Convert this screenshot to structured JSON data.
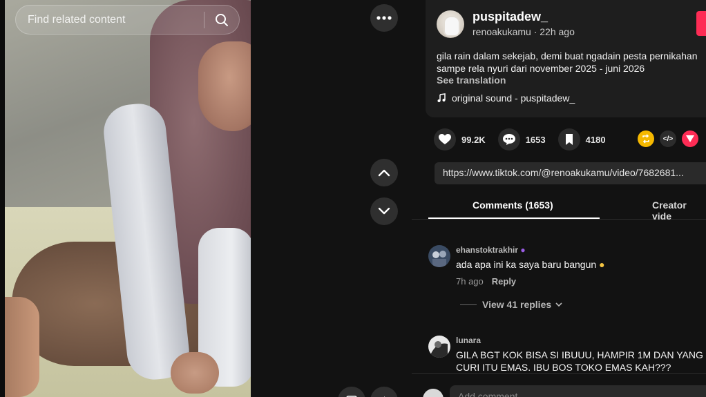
{
  "search": {
    "placeholder": "Find related content"
  },
  "post": {
    "username": "puspitadew_",
    "handle_time": "renoakukamu · 22h ago",
    "description_line1": "gila rain dalam sekejab, demi buat ngadain pesta pernikahan",
    "description_line2": "sampe rela nyuri dari november 2025 - juni 2026",
    "see_translation": "See translation",
    "sound": "original sound - puspitadew_"
  },
  "actions": {
    "likes": "99.2K",
    "comments": "1653",
    "saves": "4180"
  },
  "link": "https://www.tiktok.com/@renoakukamu/video/7682681...",
  "tabs": [
    {
      "label": "Comments (1653)"
    },
    {
      "label": "Creator vide"
    }
  ],
  "comments": [
    {
      "username": "ehanstoktrakhir",
      "text": "ada apa ini ka saya baru bangun",
      "time": "7h ago",
      "reply": "Reply",
      "view_replies": "View 41 replies"
    },
    {
      "username": "lunara",
      "text_line1": "GILA BGT KOK BISA SI IBUUU, HAMPIR 1M DAN YANG",
      "text_line2": "CURI ITU EMAS. IBU BOS TOKO EMAS KAH???"
    }
  ],
  "add_comment": {
    "placeholder": "Add comment..."
  },
  "icons": {
    "search": "search-icon",
    "more": "more-icon",
    "up": "chevron-up-icon",
    "down": "chevron-down-icon",
    "heart": "heart-icon",
    "comment": "comment-icon",
    "bookmark": "bookmark-icon",
    "music": "music-note-icon"
  },
  "colors": {
    "accent": "#fe2c55",
    "background": "#121212",
    "card": "#1e1e1e"
  }
}
